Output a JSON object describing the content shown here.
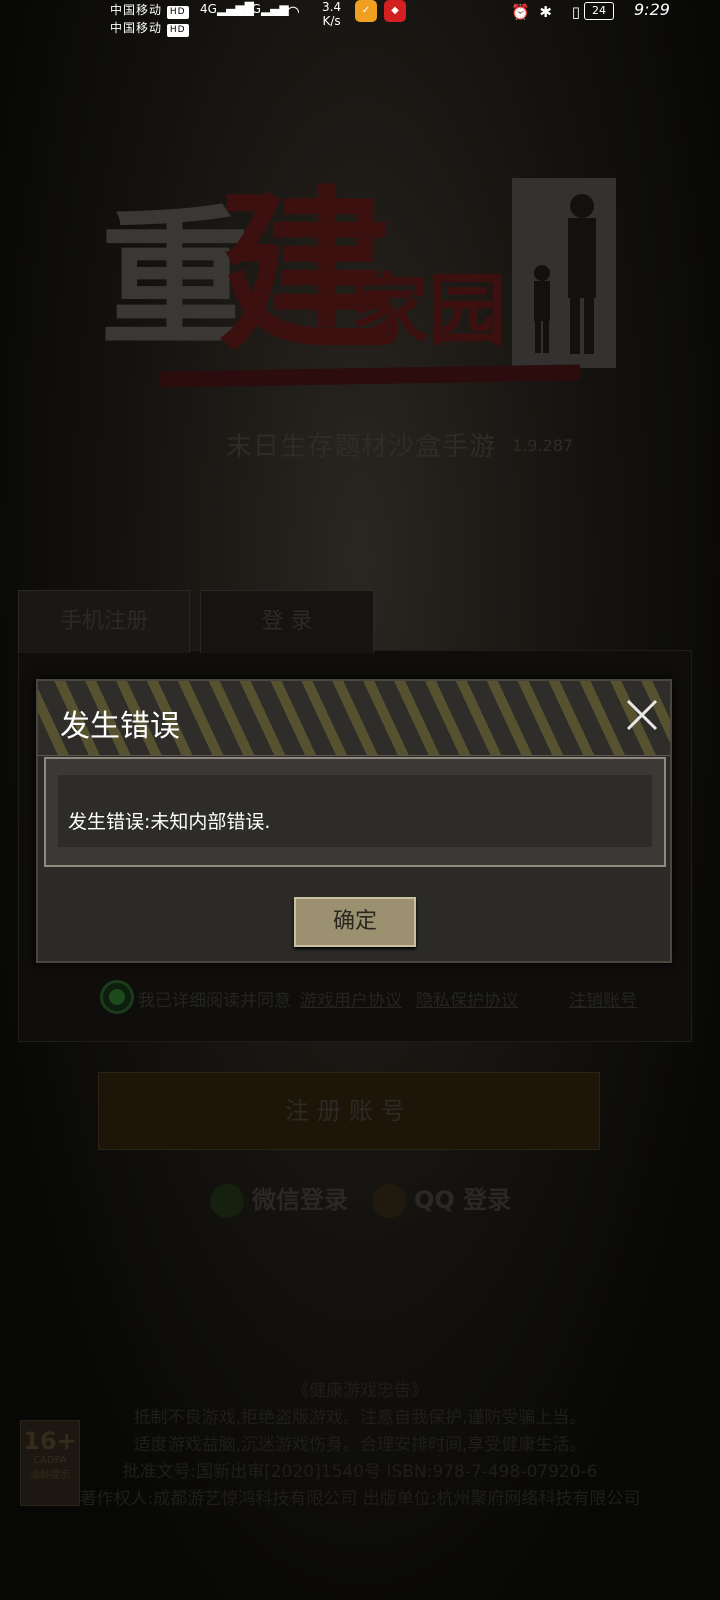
{
  "status_bar": {
    "carrier_1": "中国移动",
    "carrier_2": "中国移动",
    "hd": "HD",
    "signal_1": "4G",
    "signal_2": "5G",
    "speed_value": "3.4",
    "speed_unit": "K/s",
    "battery": "24",
    "time": "9:29"
  },
  "game": {
    "logo_char_1": "重",
    "logo_char_2": "建",
    "logo_rest": "家园",
    "subtitle": "末日生存题材沙盒手游",
    "version": "1.9.287"
  },
  "tabs": [
    {
      "label": "手机注册"
    },
    {
      "label": "登 录"
    }
  ],
  "agreement": {
    "text": "我已详细阅读并同意",
    "link_user": "游戏用户协议",
    "link_privacy": "隐私保护协议",
    "cancel": "注销账号"
  },
  "register_button": "注册账号",
  "social": {
    "wechat": "微信登录",
    "qq": "QQ 登录"
  },
  "notice": {
    "title": "《健康游戏忠告》",
    "line1": "抵制不良游戏,拒绝盗版游戏。注意自我保护,谨防受骗上当。",
    "line2": "适度游戏益脑,沉迷游戏伤身。合理安排时间,享受健康生活。",
    "line3": "批准文号:国新出审[2020]1540号  ISBN:978-7-498-07920-6",
    "line4": "著作权人:成都游艺惊鸿科技有限公司 出版单位:杭州聚府网络科技有限公司"
  },
  "age_rating": {
    "number": "16+",
    "label1": "CADPA",
    "label2": "适龄提示"
  },
  "dialog": {
    "title": "发生错误",
    "message": "发生错误:未知内部错误.",
    "ok": "确定"
  }
}
